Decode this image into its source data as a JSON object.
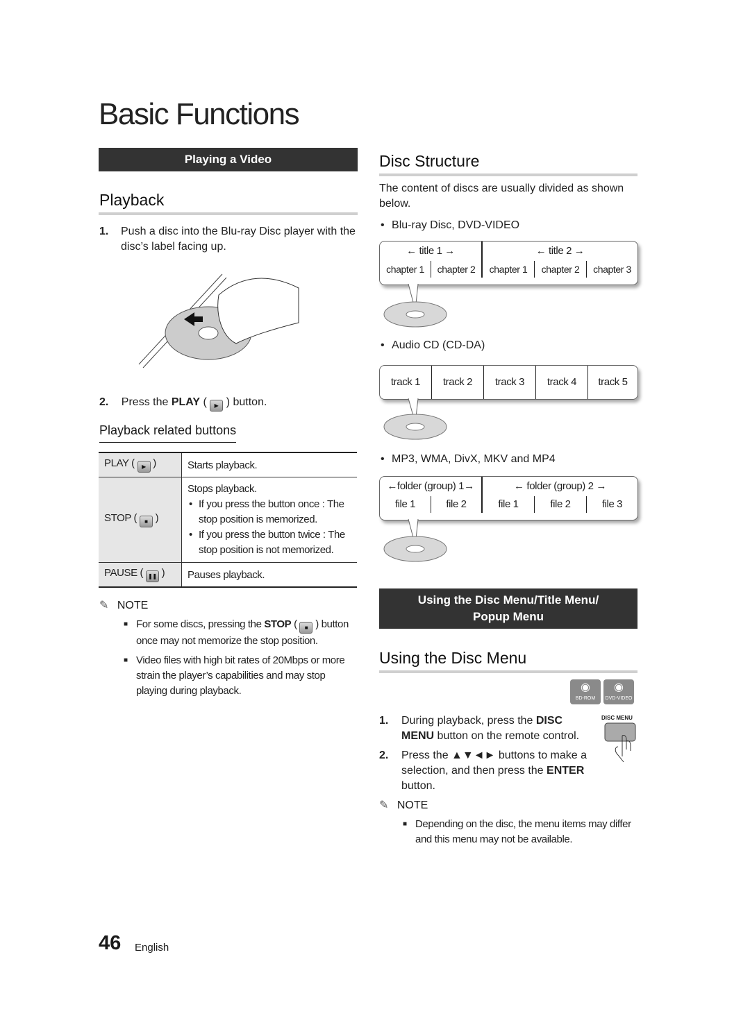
{
  "page_title": "Basic Functions",
  "left": {
    "section_bar": "Playing a Video",
    "heading": "Playback",
    "step1_num": "1.",
    "step1_text": "Push a disc into the Blu-ray Disc player with the disc’s label facing up.",
    "step2_num": "2.",
    "step2_pre": "Press the ",
    "step2_bold": "PLAY",
    "step2_post": " button.",
    "subheading": "Playback related buttons",
    "table": [
      {
        "key": "PLAY",
        "icon": "play",
        "desc": [
          "Starts playback."
        ],
        "bullets": []
      },
      {
        "key": "STOP",
        "icon": "stop",
        "desc": [
          "Stops playback."
        ],
        "bullets": [
          "If you press the button once : The stop position is memorized.",
          "If you press the button twice : The stop position is not memorized."
        ]
      },
      {
        "key": "PAUSE",
        "icon": "pause",
        "desc": [
          "Pauses playback."
        ],
        "bullets": []
      }
    ],
    "note_label": "NOTE",
    "notes": [
      {
        "pre": "For some discs, pressing the ",
        "bold": "STOP",
        "post": " button once may not memorize the stop position."
      },
      {
        "pre": "Video files with high bit rates of 20Mbps or more strain the player’s capabilities and may stop playing during playback.",
        "bold": "",
        "post": ""
      }
    ]
  },
  "right": {
    "heading": "Disc Structure",
    "intro": "The content of discs are usually divided as shown below.",
    "bd_label": "Blu-ray Disc, DVD-VIDEO",
    "bd_titles": [
      "title 1",
      "title 2"
    ],
    "bd_chapters": [
      "chapter 1",
      "chapter 2",
      "chapter 1",
      "chapter 2",
      "chapter 3"
    ],
    "cd_label": "Audio CD (CD-DA)",
    "cd_tracks": [
      "track 1",
      "track 2",
      "track 3",
      "track 4",
      "track 5"
    ],
    "mp3_label": "MP3, WMA, DivX, MKV and MP4",
    "mp3_folders": [
      "folder (group) 1",
      "folder (group) 2"
    ],
    "mp3_files": [
      "file 1",
      "file 2",
      "file 1",
      "file 2",
      "file 3"
    ],
    "section_bar_line1": "Using the Disc Menu/Title Menu/",
    "section_bar_line2": "Popup Menu",
    "heading2": "Using the Disc Menu",
    "badges": [
      "BD-ROM",
      "DVD-VIDEO"
    ],
    "remote_label": "DISC MENU",
    "step1_num": "1.",
    "step1_pre": "During playback, press the ",
    "step1_bold": "DISC MENU",
    "step1_post": " button on the remote control.",
    "step2_num": "2.",
    "step2_pre": "Press the ▲▼◄► buttons to make a selection, and then press the ",
    "step2_bold": "ENTER",
    "step2_post": " button.",
    "note_label": "NOTE",
    "note": "Depending on the disc, the menu items may differ and this menu may not be available."
  },
  "footer": {
    "page_number": "46",
    "language": "English"
  }
}
